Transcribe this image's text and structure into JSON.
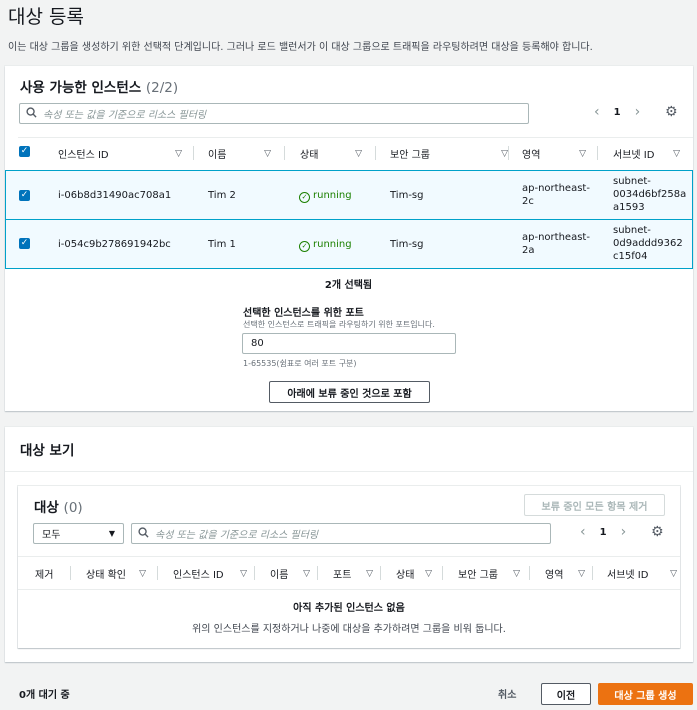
{
  "page": {
    "title": "대상 등록",
    "description": "이는 대상 그룹을 생성하기 위한 선택적 단계입니다. 그러나 로드 밸런서가 이 대상 그룹으로 트래픽을 라우팅하려면 대상을 등록해야 합니다."
  },
  "available": {
    "heading": "사용 가능한 인스턴스",
    "count": "(2/2)",
    "search_placeholder": "속성 또는 값을 기준으로 리소스 필터링",
    "page_number": "1",
    "columns": [
      "인스턴스 ID",
      "이름",
      "상태",
      "보안 그룹",
      "영역",
      "서브넷 ID"
    ],
    "rows": [
      {
        "id": "i-06b8d31490ac708a1",
        "name": "Tim 2",
        "state": "running",
        "sg": "Tim-sg",
        "zone_l1": "ap-northeast-",
        "zone_l2": "2c",
        "subnet_l1": "subnet-",
        "subnet_l2": "0034d6bf258a",
        "subnet_l3": "a1593"
      },
      {
        "id": "i-054c9b278691942bc",
        "name": "Tim 1",
        "state": "running",
        "sg": "Tim-sg",
        "zone_l1": "ap-northeast-",
        "zone_l2": "2a",
        "subnet_l1": "subnet-",
        "subnet_l2": "0d9addd9362",
        "subnet_l3": "c15f04"
      }
    ],
    "selected_text": "2개 선택됨",
    "port_label": "선택한 인스턴스를 위한 포트",
    "port_help": "선택한 인스턴스로 트래픽을 라우팅하기 위한 포트입니다.",
    "port_value": "80",
    "port_constraint": "1-65535(쉼표로 여러 포트 구분)",
    "include_button": "아래에 보류 중인 것으로 포함"
  },
  "review": {
    "heading": "대상 보기",
    "targets_label": "대상",
    "targets_count": "(0)",
    "remove_all_button": "보류 중인 모든 항목 제거",
    "filter_select": "모두",
    "search_placeholder": "속성 또는 값을 기준으로 리소스 필터링",
    "page_number": "1",
    "columns": [
      "제거",
      "상태 확인",
      "인스턴스 ID",
      "이름",
      "포트",
      "상태",
      "보안 그룹",
      "영역",
      "서브넷 ID"
    ],
    "empty_title": "아직 추가된 인스턴스 없음",
    "empty_desc": "위의 인스턴스를 지정하거나 나중에 대상을 추가하려면 그룹을 비워 둡니다."
  },
  "footer": {
    "pending": "0개 대기 중",
    "cancel": "취소",
    "previous": "이전",
    "create": "대상 그룹 생성"
  },
  "colors": {
    "primary": "#ec7211",
    "selected_row": "#f1faff",
    "selected_border": "#00a1c9",
    "running": "#1d8102",
    "checkbox": "#0073bb"
  }
}
